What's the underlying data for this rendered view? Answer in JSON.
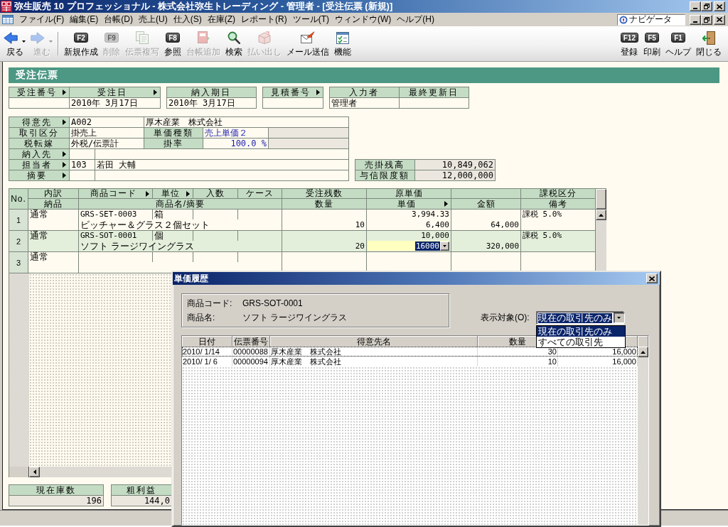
{
  "window": {
    "title": "弥生販売 10 プロフェッショナル - 株式会社弥生トレーディング - 管理者 - [受注伝票 (新規)]"
  },
  "menu_bar": {
    "items": [
      "ファイル(F)",
      "編集(E)",
      "台帳(D)",
      "売上(U)",
      "仕入(S)",
      "在庫(Z)",
      "レポート(R)",
      "ツール(T)",
      "ウィンドウ(W)",
      "ヘルプ(H)"
    ],
    "navigator": "ナビゲータ"
  },
  "toolbar": {
    "left": [
      {
        "kind": "nav",
        "label": "戻る",
        "disabled": false
      },
      {
        "kind": "nav",
        "label": "進む",
        "disabled": true
      },
      {
        "kind": "key",
        "key": "F2",
        "label": "新規作成",
        "disabled": false
      },
      {
        "kind": "key",
        "key": "F9",
        "label": "削除",
        "disabled": true
      },
      {
        "kind": "icon",
        "label": "伝票複写",
        "disabled": true
      },
      {
        "kind": "key",
        "key": "F8",
        "label": "参照",
        "disabled": false
      },
      {
        "kind": "icon",
        "label": "台帳追加",
        "disabled": true
      },
      {
        "kind": "icon",
        "label": "検索",
        "disabled": false
      },
      {
        "kind": "icon",
        "label": "払い出し",
        "disabled": true
      },
      {
        "kind": "icon",
        "label": "メール送信",
        "disabled": false
      },
      {
        "kind": "icon",
        "label": "機能",
        "disabled": false
      }
    ],
    "right": [
      {
        "kind": "key",
        "key": "F12",
        "label": "登録",
        "disabled": false
      },
      {
        "kind": "key",
        "key": "F5",
        "label": "印刷",
        "disabled": false
      },
      {
        "kind": "key",
        "key": "F1",
        "label": "ヘルプ",
        "disabled": false
      },
      {
        "kind": "icon",
        "label": "閉じる",
        "disabled": false
      }
    ]
  },
  "document": {
    "title": "受注伝票",
    "header_groups": [
      {
        "fields": [
          {
            "label": "受注番号",
            "lookup": true
          },
          {
            "label": "受注日",
            "lookup": true,
            "value": "2010年 3月17日"
          }
        ]
      },
      {
        "fields": [
          {
            "label": "納入期日",
            "lookup": false,
            "value": "2010年 3月17日"
          }
        ]
      },
      {
        "fields": [
          {
            "label": "見積番号",
            "lookup": true
          }
        ]
      },
      {
        "fields": [
          {
            "label": "入力者",
            "lookup": false,
            "value": "管理者"
          },
          {
            "label": "最終更新日",
            "lookup": false
          }
        ]
      }
    ],
    "customer_rows": [
      {
        "kind": "wide_code",
        "label": "得意先",
        "lookup": true,
        "code": "A002",
        "name": "厚木産業　株式会社"
      },
      {
        "kind": "pair",
        "label": "取引区分",
        "lookup": false,
        "value": "掛売上",
        "sub_label": "単価種類",
        "sub_value": "売上単価２"
      },
      {
        "kind": "pair",
        "label": "税転嫁",
        "lookup": false,
        "value": "外税/伝票計",
        "sub_label": "掛率",
        "sub_value": "100.0 %"
      },
      {
        "kind": "code_name",
        "label": "納入先",
        "lookup": true
      },
      {
        "kind": "code_name",
        "label": "担当者",
        "lookup": true,
        "code": "103",
        "name": "若田 大輔"
      },
      {
        "kind": "code_name",
        "label": "摘要",
        "lookup": true
      }
    ],
    "balances": [
      {
        "label": "売掛残高",
        "value": "10,849,062"
      },
      {
        "label": "与信限度額",
        "value": "12,000,000"
      }
    ],
    "lines_table": {
      "no_header": "No.",
      "header_top": [
        {
          "label": "内訳",
          "lookup": false
        },
        {
          "label": "商品コード",
          "lookup": true
        },
        {
          "label": "単位",
          "lookup": true
        },
        {
          "label": "入数",
          "lookup": false
        },
        {
          "label": "ケース",
          "lookup": false
        },
        {
          "label": "受注残数",
          "lookup": false
        },
        {
          "label": "原単価",
          "lookup": false
        },
        {
          "lookup": false
        },
        {
          "label": "課税区分",
          "lookup": false
        }
      ],
      "header_bottom": [
        {
          "label": "納品",
          "lookup": false
        },
        {
          "label": "商品名/摘要",
          "lookup": false
        },
        {
          "label": "数量",
          "lookup": false
        },
        {
          "label": "単価",
          "lookup": true
        },
        {
          "label": "金額",
          "lookup": false
        },
        {
          "label": "備考",
          "lookup": false
        }
      ],
      "rows": [
        {
          "no": "1",
          "selected": false,
          "breakdown": "通常",
          "code": "GRS-SET-0003",
          "unit": "箱",
          "name": "ピッチャー＆グラス２個セット",
          "quantity": "10",
          "cost_price": "3,994.33",
          "unit_price": "6,400",
          "amount": "64,000",
          "tax": "課税 5.0%",
          "editing": false
        },
        {
          "no": "2",
          "selected": true,
          "breakdown": "通常",
          "code": "GRS-SOT-0001",
          "unit": "個",
          "name": "ソフト ラージワイングラス",
          "quantity": "20",
          "cost_price": "10,000",
          "unit_price": "16000",
          "amount": "320,000",
          "tax": "課税 5.0%",
          "editing": true
        },
        {
          "no": "3",
          "selected": false,
          "breakdown": "通常",
          "editing": false
        }
      ]
    },
    "summary": [
      {
        "label": "現在庫数",
        "value": "196"
      },
      {
        "label": "粗利益",
        "value": "144,0"
      }
    ]
  },
  "dialog": {
    "title": "単価履歴",
    "product_code_label": "商品コード:",
    "product_code": "GRS-SOT-0001",
    "product_name_label": "商品名:",
    "product_name": "ソフト ラージワイングラス",
    "filter": {
      "label": "表示対象(O):",
      "value": "現在の取引先のみ",
      "focused": true,
      "expanded": true,
      "options": [
        {
          "label": "現在の取引先のみ",
          "selected": true
        },
        {
          "label": "すべての取引先",
          "selected": false
        }
      ]
    },
    "history": {
      "columns": [
        "日付",
        "伝票番号",
        "得意先名",
        "数量"
      ],
      "rows": [
        {
          "date": "2010/ 1/14",
          "slip_no": "00000088",
          "customer": "厚木産業　株式会社",
          "quantity": "30",
          "price": "16,000",
          "selected": true
        },
        {
          "date": "2010/ 1/ 6",
          "slip_no": "00000094",
          "customer": "厚木産業　株式会社",
          "quantity": "10",
          "price": "16,000",
          "selected": false
        }
      ]
    }
  }
}
